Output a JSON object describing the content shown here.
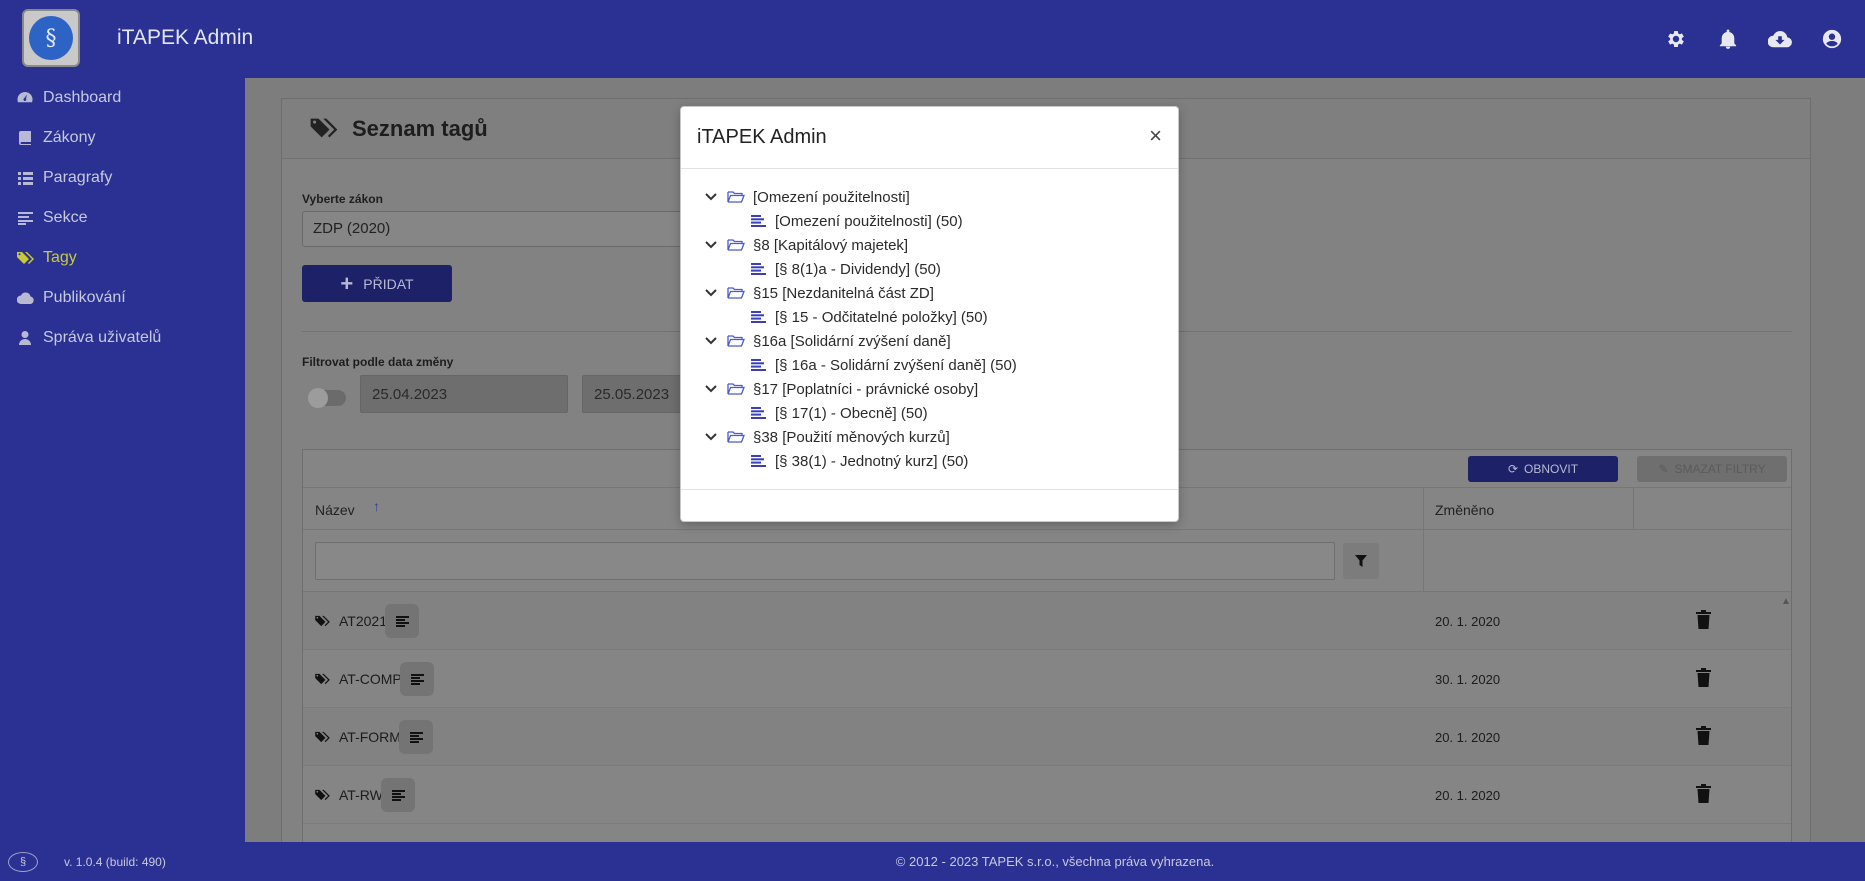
{
  "app": {
    "title": "iTAPEK Admin",
    "logo_glyph": "§"
  },
  "topbar": {
    "icons": [
      "gear-icon",
      "bell-icon",
      "cloud-download-icon",
      "user-circle-icon"
    ]
  },
  "sidebar": {
    "items": [
      {
        "label": "Dashboard",
        "icon": "dashboard-icon"
      },
      {
        "label": "Zákony",
        "icon": "book-icon"
      },
      {
        "label": "Paragrafy",
        "icon": "list-icon"
      },
      {
        "label": "Sekce",
        "icon": "section-icon"
      },
      {
        "label": "Tagy",
        "icon": "tags-icon",
        "active": true
      },
      {
        "label": "Publikování",
        "icon": "cloud-icon"
      },
      {
        "label": "Správa uživatelů",
        "icon": "user-icon"
      }
    ],
    "version": "v. 1.0.4 (build: 490)"
  },
  "footer": {
    "copyright": "© 2012 - 2023 TAPEK s.r.o., všechna práva vyhrazena."
  },
  "page": {
    "title": "Seznam tagů",
    "law_label": "Vyberte zákon",
    "law_value": "ZDP (2020)",
    "add_button": "PŘIDAT",
    "filter_label": "Filtrovat podle data změny",
    "date_from": "25.04.2023",
    "date_to": "25.05.2023",
    "refresh_button": "OBNOVIT",
    "clear_filters_button": "SMAZAT FILTRY",
    "columns": {
      "name": "Název",
      "changed": "Změněno"
    },
    "sort_indicator": "↑",
    "rows": [
      {
        "name": "AT2021",
        "changed": "20. 1. 2020"
      },
      {
        "name": "AT-COMP",
        "changed": "30. 1. 2020"
      },
      {
        "name": "AT-FORM",
        "changed": "20. 1. 2020"
      },
      {
        "name": "AT-RW",
        "changed": "20. 1. 2020"
      }
    ]
  },
  "modal": {
    "title": "iTAPEK Admin",
    "close_glyph": "×",
    "tree": [
      {
        "group": "[Omezení použitelnosti]",
        "item": "[Omezení použitelnosti] (50)"
      },
      {
        "group": "§8 [Kapitálový majetek]",
        "item": "[§ 8(1)a - Dividendy] (50)"
      },
      {
        "group": "§15 [Nezdanitelná část ZD]",
        "item": "[§ 15 - Odčitatelné položky] (50)"
      },
      {
        "group": "§16a [Solidární zvýšení daně]",
        "item": "[§ 16a - Solidární zvýšení daně] (50)"
      },
      {
        "group": "§17 [Poplatníci - právnické osoby]",
        "item": "[§ 17(1) - Obecně] (50)"
      },
      {
        "group": "§38 [Použití měnových kurzů]",
        "item": "[§ 38(1) - Jednotný kurz] (50)"
      }
    ]
  },
  "colors": {
    "brand": "#2a3193",
    "active_nav": "#c9cb36",
    "tree_icon": "#4a5ad0"
  }
}
